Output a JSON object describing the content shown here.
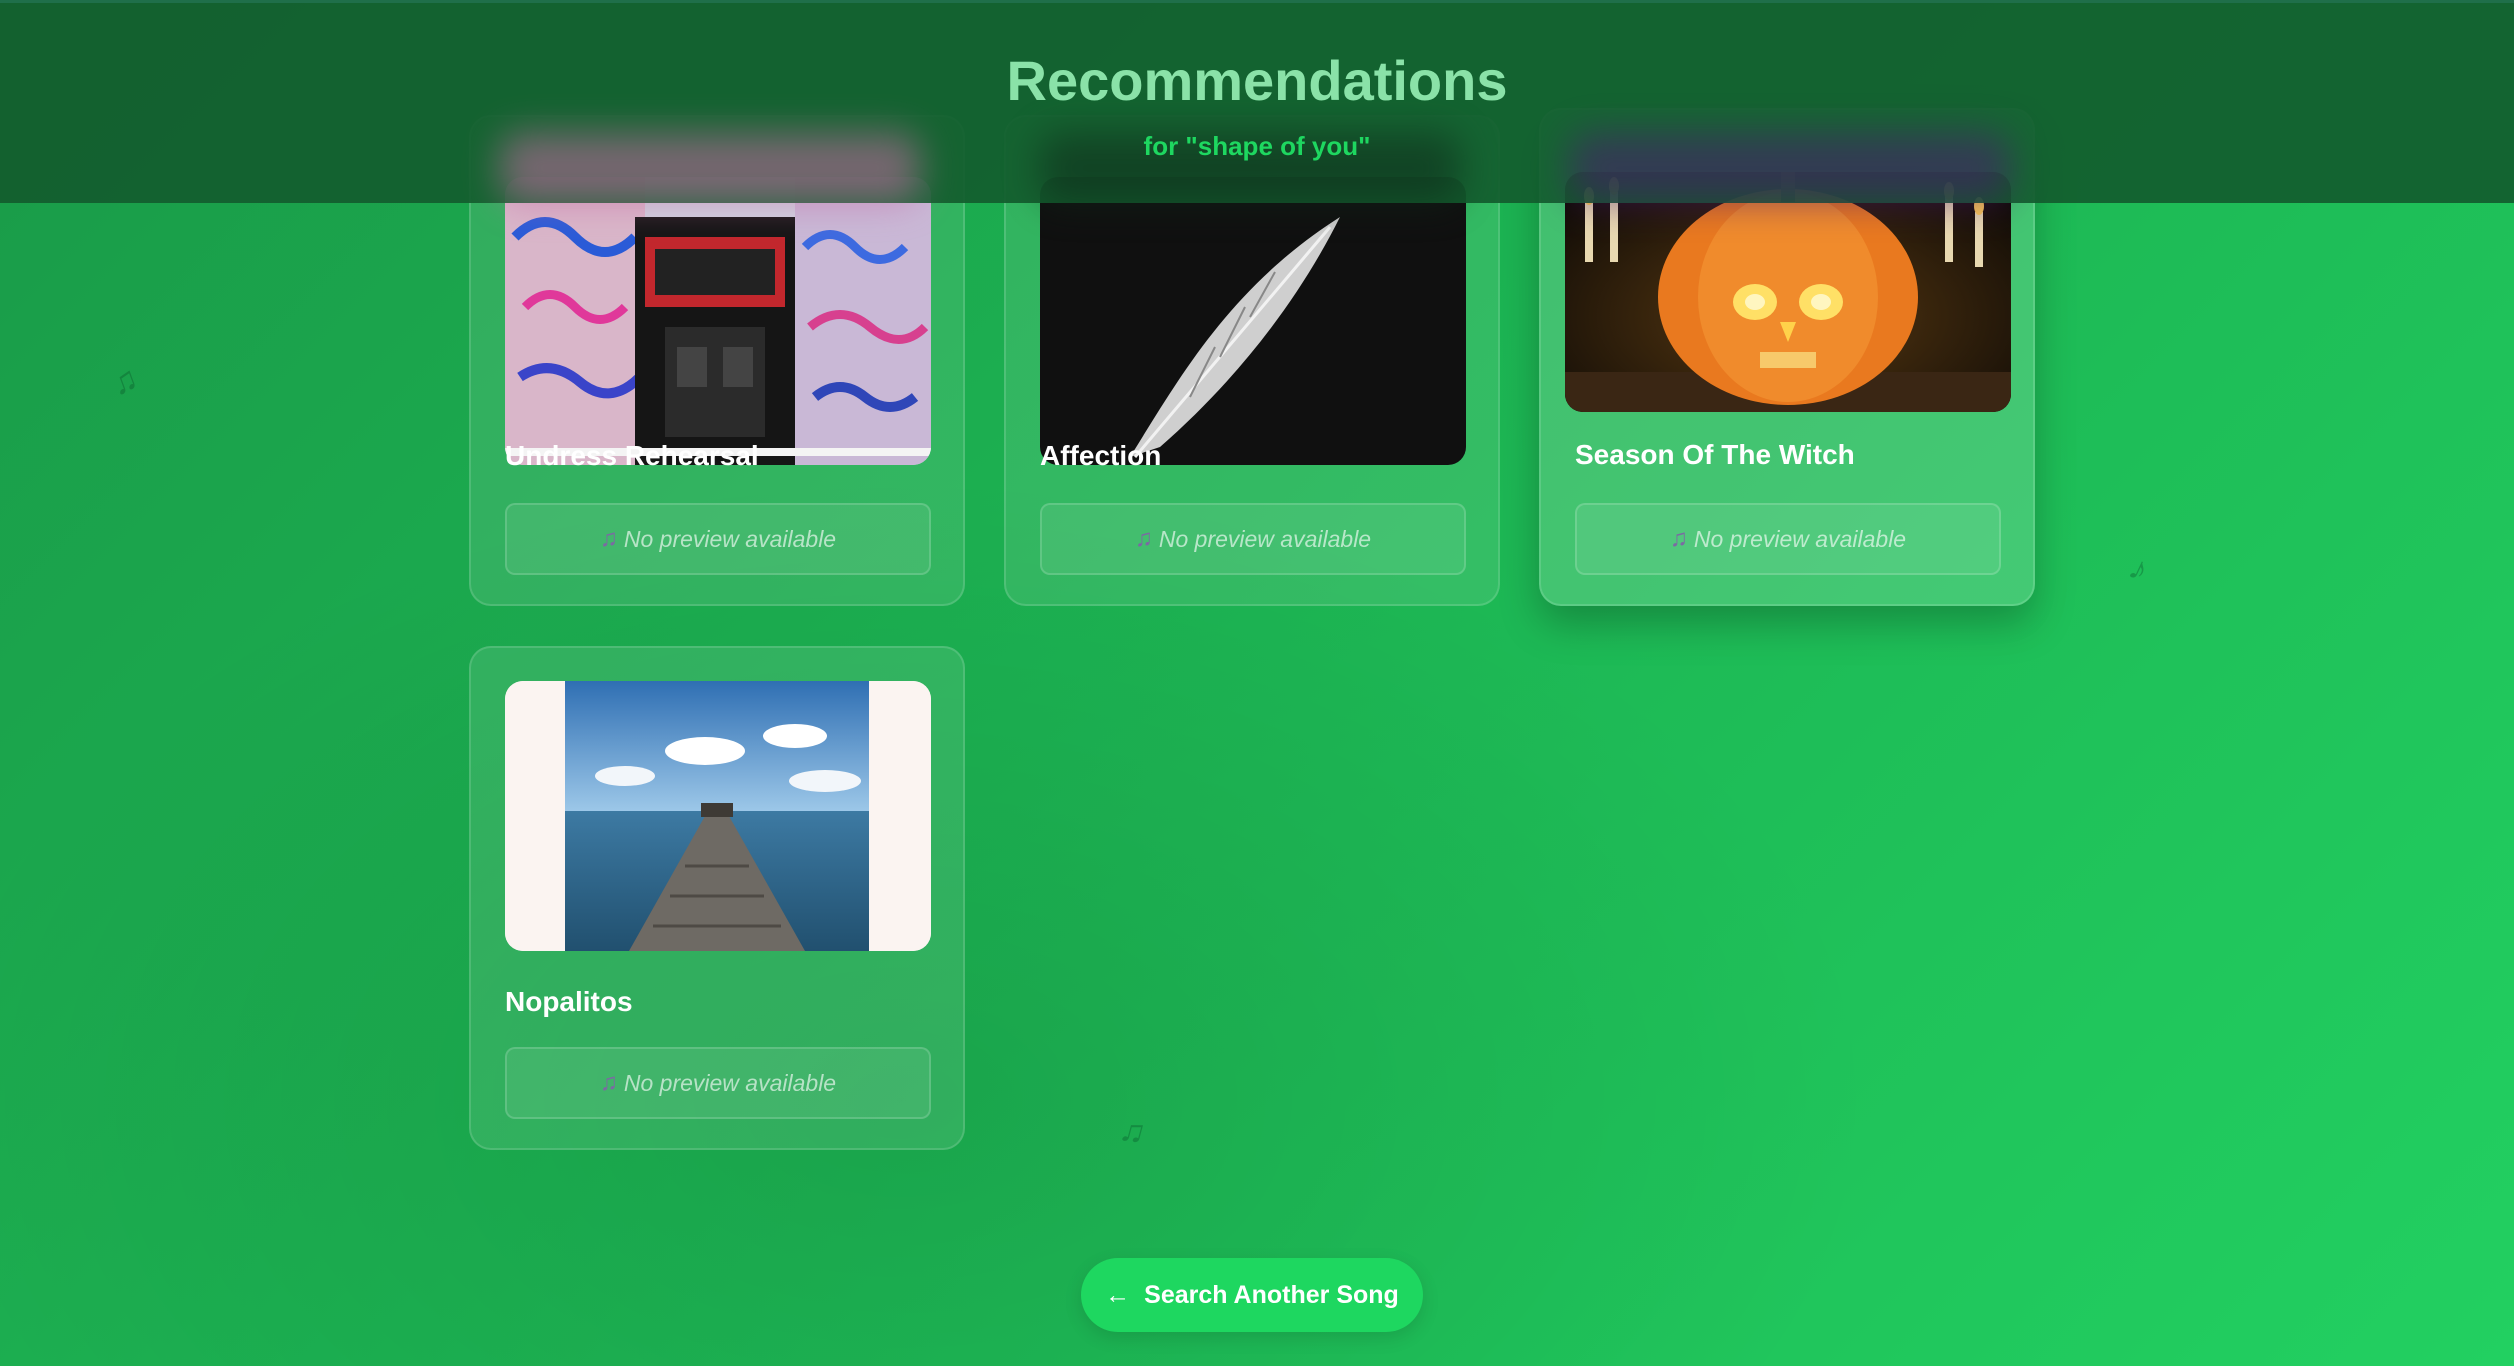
{
  "header": {
    "title": "Recommendations",
    "subtitle": "for \"shape of you\""
  },
  "cards": [
    {
      "title": "Undress Rehearsal",
      "preview_text": "No preview available"
    },
    {
      "title": "Affection",
      "preview_text": "No preview available"
    },
    {
      "title": "Season Of The Witch",
      "preview_text": "No preview available"
    },
    {
      "title": "Nopalitos",
      "preview_text": "No preview available"
    }
  ],
  "icons": {
    "music_note": "music-note-icon",
    "back_arrow": "arrow-left-icon"
  },
  "actions": {
    "back_arrow": "←",
    "back_label": "Search Another Song"
  },
  "colors": {
    "accent": "#1ed760",
    "title": "#8ae2a8",
    "header_bg": "#125c2e"
  }
}
